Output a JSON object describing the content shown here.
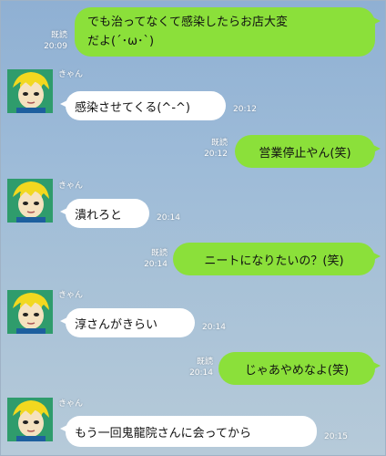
{
  "colors": {
    "sent_bubble": "#8be03a",
    "recv_bubble": "#ffffff",
    "background": "#9dbbd8"
  },
  "messages": [
    {
      "type": "sent",
      "read": "既読",
      "time": "20:09",
      "text_line1": "でも治ってなくて感染したらお店大変",
      "text_line2": "だよ(´･ω･`)"
    },
    {
      "type": "received",
      "sender": "きゃん",
      "text": "感染させてくる(^-^)",
      "time": "20:12"
    },
    {
      "type": "sent",
      "read": "既読",
      "time": "20:12",
      "text": "営業停止やん(笑)"
    },
    {
      "type": "received",
      "sender": "きゃん",
      "text": "潰れろと",
      "time": "20:14"
    },
    {
      "type": "sent",
      "read": "既読",
      "time": "20:14",
      "text": "ニートになりたいの？(笑)"
    },
    {
      "type": "received",
      "sender": "きゃん",
      "text": "淳さんがきらい",
      "time": "20:14"
    },
    {
      "type": "sent",
      "read": "既読",
      "time": "20:14",
      "text": "じゃあやめなよ(笑)"
    },
    {
      "type": "received",
      "sender": "きゃん",
      "text": "もう一回鬼龍院さんに会ってから",
      "time": "20:15"
    }
  ]
}
